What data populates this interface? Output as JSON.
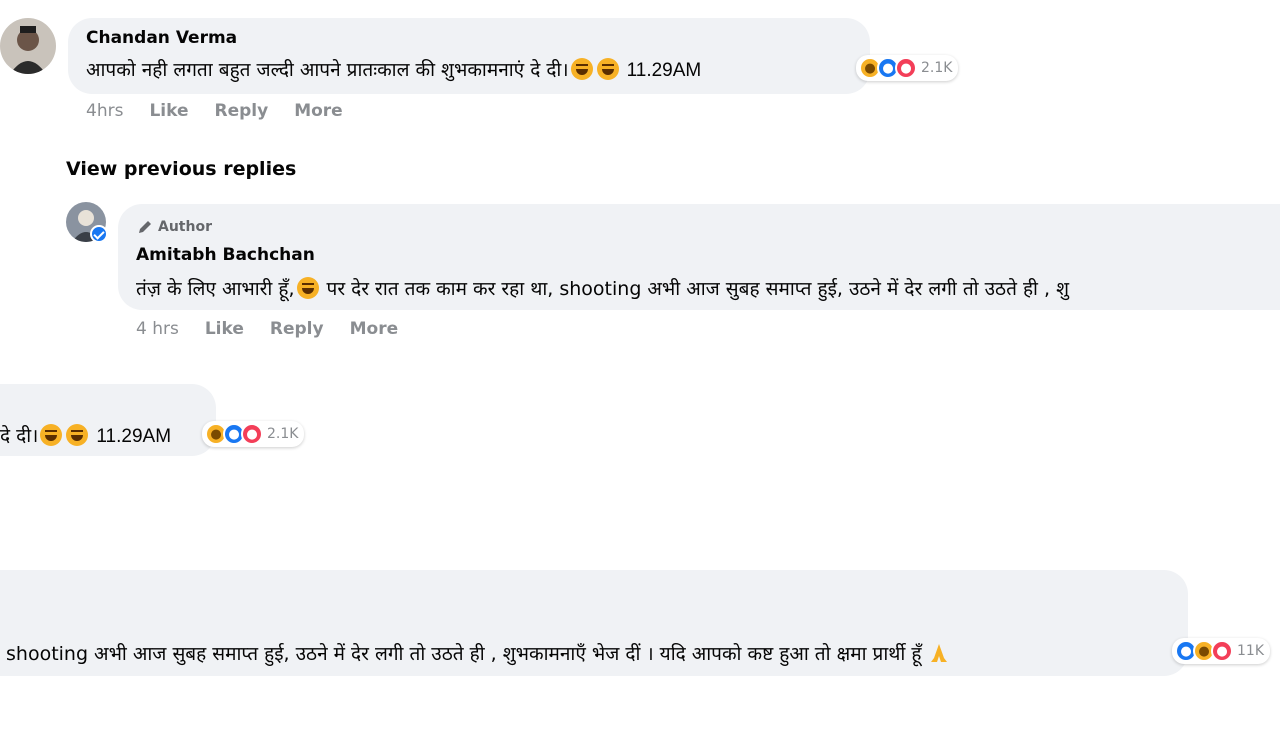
{
  "comment": {
    "author": "Chandan Verma",
    "text": "आपको नही लगता बहुत जल्दी आपने प्रातःकाल की शुभकामनाएं दे दी।",
    "time_text": "11.29AM",
    "reaction_count": "2.1K",
    "actions": {
      "timestamp": "4hrs",
      "like": "Like",
      "reply": "Reply",
      "more": "More"
    }
  },
  "view_previous_replies": "View previous replies",
  "reply": {
    "badge": "Author",
    "author": "Amitabh Bachchan",
    "text": "तंज़ के लिए आभारी हूँ,",
    "text_cont": " पर देर रात तक काम कर रहा था, shooting अभी आज सुबह समाप्त हुई, उठने में देर लगी तो उठते ही , शु",
    "actions": {
      "timestamp": "4 hrs",
      "like": "Like",
      "reply": "Reply",
      "more": "More"
    }
  },
  "crop_comment": {
    "text_end": "दे दी।",
    "time_text": "11.29AM",
    "reaction_count": "2.1K"
  },
  "crop_reply": {
    "text": "shooting अभी आज सुबह समाप्त हुई, उठने में देर लगी तो उठते ही , शुभकामनाएँ भेज दीं । यदि आपको कष्ट हुआ तो क्षमा प्रार्थी हूँ",
    "reaction_count": "11K"
  },
  "icons": {
    "reactions": [
      "haha-icon",
      "like-icon",
      "love-icon"
    ],
    "inline": [
      "rofl-emoji",
      "grin-emoji",
      "pray-emoji",
      "pencil-icon",
      "verified-badge-icon"
    ]
  },
  "colors": {
    "bubble": "#f0f2f5",
    "meta_text": "#8a8d91",
    "like_blue": "#1877f2",
    "love_red": "#f33e58",
    "haha_yellow": "#f7b125"
  }
}
